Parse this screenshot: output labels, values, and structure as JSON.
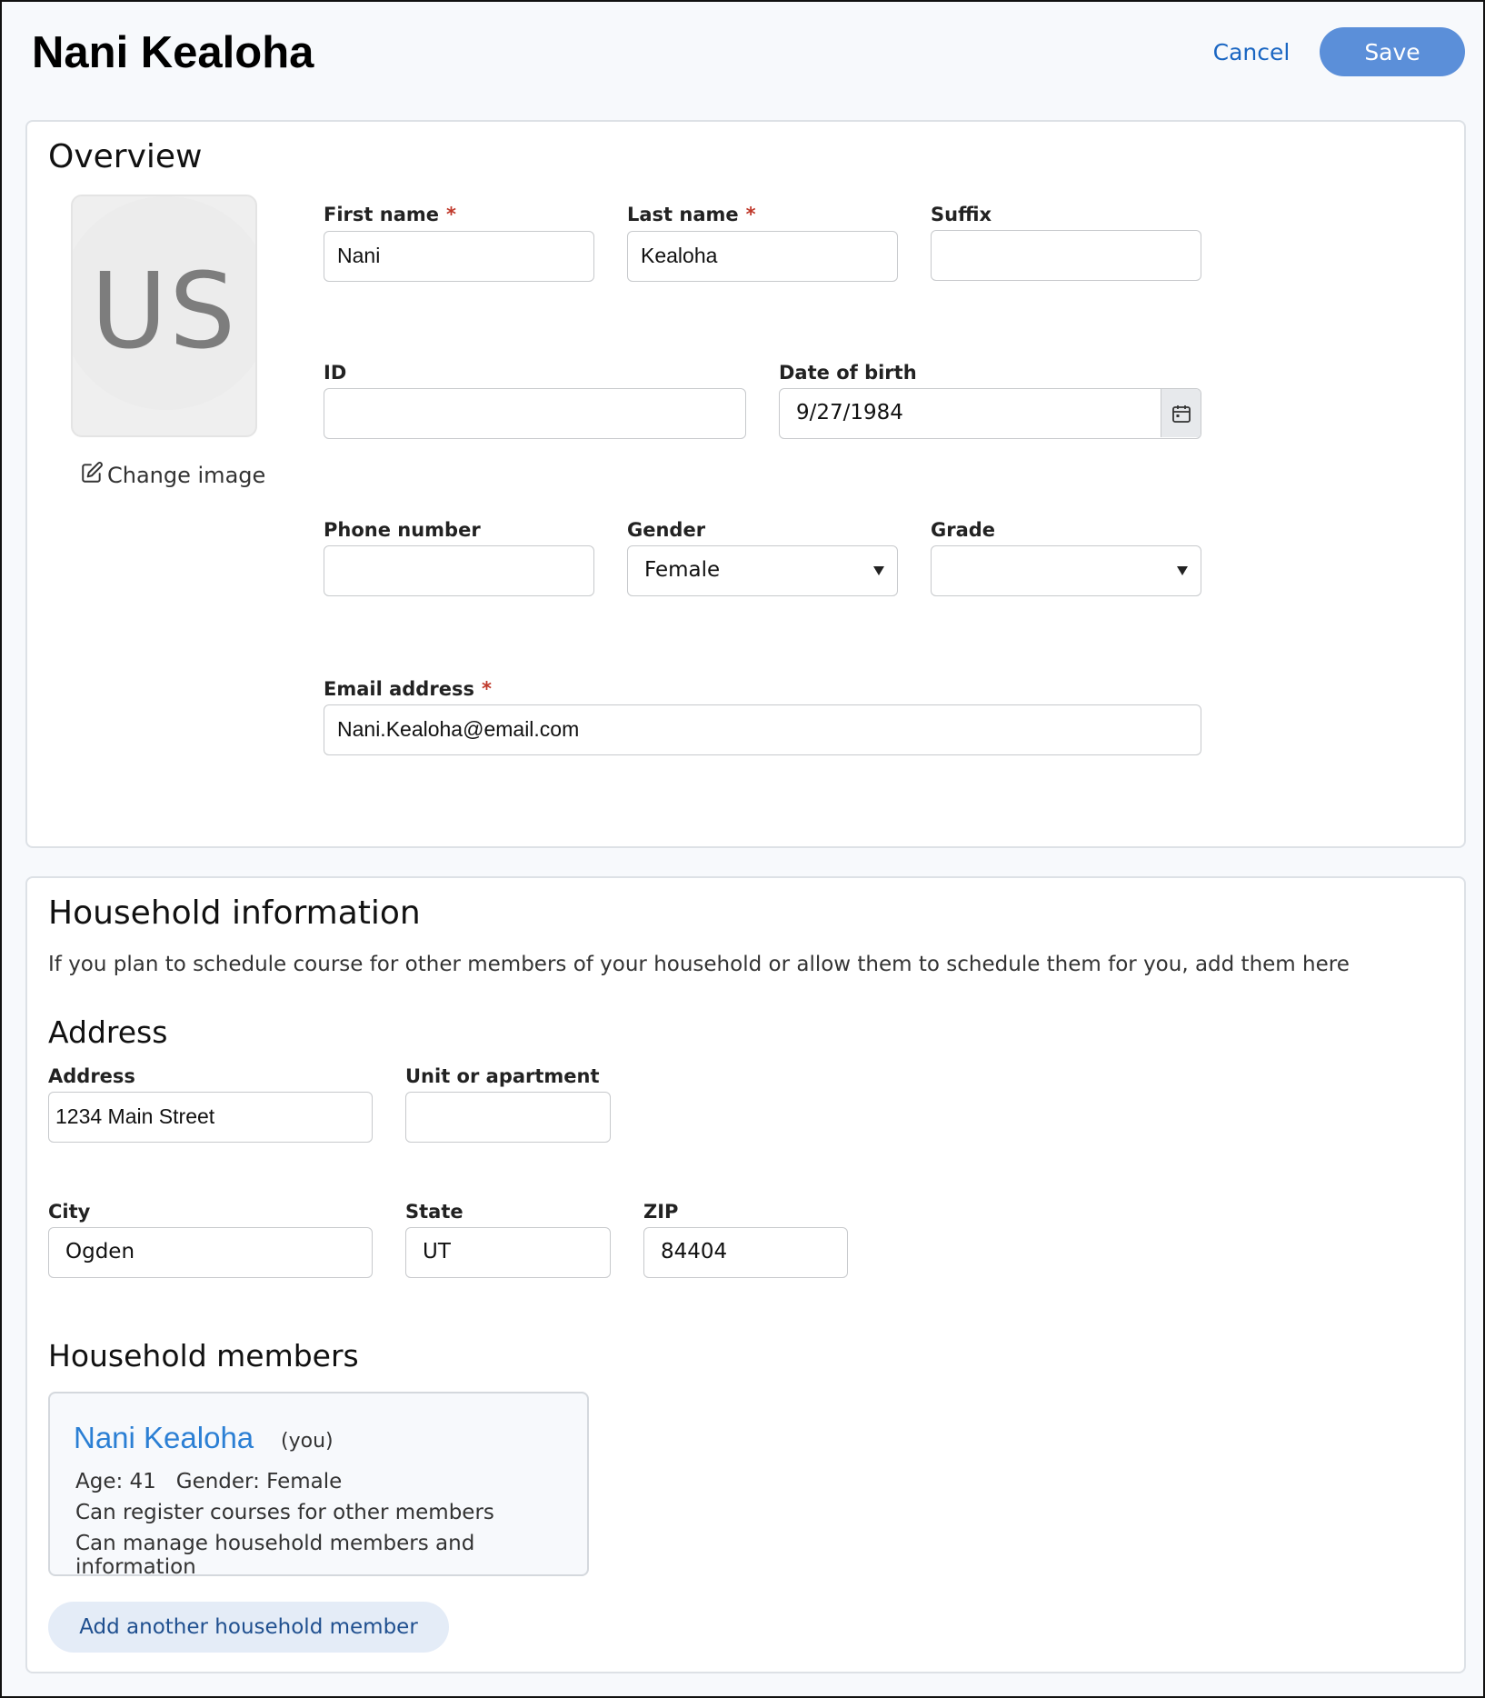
{
  "header": {
    "title": "Nani Kealoha",
    "cancel_label": "Cancel",
    "save_label": "Save"
  },
  "overview": {
    "heading": "Overview",
    "avatar_initials": "US",
    "change_image_label": "Change image",
    "first_name": {
      "label": "First name",
      "value": "Nani",
      "required": true
    },
    "last_name": {
      "label": "Last name",
      "value": "Kealoha",
      "required": true
    },
    "suffix": {
      "label": "Suffix",
      "value": ""
    },
    "id": {
      "label": "ID",
      "value": ""
    },
    "dob": {
      "label": "Date of birth",
      "value": "9/27/1984"
    },
    "phone": {
      "label": "Phone number",
      "value": ""
    },
    "gender": {
      "label": "Gender",
      "value": "Female"
    },
    "grade": {
      "label": "Grade",
      "value": ""
    },
    "email": {
      "label": "Email address",
      "value": "Nani.Kealoha@email.com",
      "required": true
    },
    "required_marker": "*"
  },
  "household": {
    "heading": "Household information",
    "description": "If you plan to schedule course for other members of your household or allow them to schedule them for you, add them here",
    "address_heading": "Address",
    "address": {
      "label": "Address",
      "value": "1234 Main Street"
    },
    "unit": {
      "label": "Unit or apartment",
      "value": ""
    },
    "city": {
      "label": "City",
      "value": "Ogden"
    },
    "state": {
      "label": "State",
      "value": "UT"
    },
    "zip": {
      "label": "ZIP",
      "value": "84404"
    },
    "members_heading": "Household members",
    "members": [
      {
        "name": "Nani Kealoha",
        "tag": "(you)",
        "age_gender": "Age: 41   Gender: Female",
        "permission_1": "Can register courses for other members",
        "permission_2": "Can manage household members and information"
      }
    ],
    "add_member_label": "Add another household member"
  },
  "icons": {
    "calendar": "calendar-icon",
    "edit": "edit-icon",
    "caret": "caret-down-icon"
  },
  "colors": {
    "accent": "#5b8fd9",
    "link": "#1a66c2",
    "member_link": "#2b7fd4",
    "required": "#c0392b"
  }
}
